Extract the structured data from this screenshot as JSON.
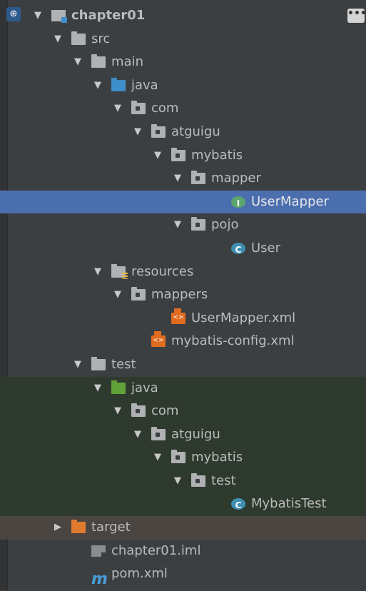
{
  "tree": [
    {
      "label": "chapter01",
      "icon": "module-icon",
      "depth": 0,
      "arrow": "down",
      "bold": true
    },
    {
      "label": "src",
      "icon": "folder-icon",
      "depth": 1,
      "arrow": "down"
    },
    {
      "label": "main",
      "icon": "folder-icon",
      "depth": 2,
      "arrow": "down"
    },
    {
      "label": "java",
      "icon": "source-folder-icon",
      "depth": 3,
      "arrow": "down"
    },
    {
      "label": "com",
      "icon": "package-icon",
      "depth": 4,
      "arrow": "down"
    },
    {
      "label": "atguigu",
      "icon": "package-icon",
      "depth": 5,
      "arrow": "down"
    },
    {
      "label": "mybatis",
      "icon": "package-icon",
      "depth": 6,
      "arrow": "down"
    },
    {
      "label": "mapper",
      "icon": "package-icon",
      "depth": 7,
      "arrow": "down"
    },
    {
      "label": "UserMapper",
      "icon": "interface-icon",
      "depth": 9,
      "arrow": "",
      "selected": true
    },
    {
      "label": "pojo",
      "icon": "package-icon",
      "depth": 7,
      "arrow": "down"
    },
    {
      "label": "User",
      "icon": "class-icon",
      "depth": 9,
      "arrow": ""
    },
    {
      "label": "resources",
      "icon": "resources-folder-icon",
      "depth": 3,
      "arrow": "down"
    },
    {
      "label": "mappers",
      "icon": "package-icon",
      "depth": 4,
      "arrow": "down"
    },
    {
      "label": "UserMapper.xml",
      "icon": "xml-file-icon",
      "depth": 6,
      "arrow": ""
    },
    {
      "label": "mybatis-config.xml",
      "icon": "xml-file-icon",
      "depth": 5,
      "arrow": ""
    },
    {
      "label": "test",
      "icon": "folder-icon",
      "depth": 2,
      "arrow": "down"
    },
    {
      "label": "java",
      "icon": "test-source-folder-icon",
      "depth": 3,
      "arrow": "down",
      "testbg": true
    },
    {
      "label": "com",
      "icon": "package-icon",
      "depth": 4,
      "arrow": "down",
      "testbg": true
    },
    {
      "label": "atguigu",
      "icon": "package-icon",
      "depth": 5,
      "arrow": "down",
      "testbg": true
    },
    {
      "label": "mybatis",
      "icon": "package-icon",
      "depth": 6,
      "arrow": "down",
      "testbg": true
    },
    {
      "label": "test",
      "icon": "package-icon",
      "depth": 7,
      "arrow": "down",
      "testbg": true
    },
    {
      "label": "MybatisTest",
      "icon": "test-class-icon",
      "depth": 9,
      "arrow": "",
      "testbg": true
    },
    {
      "label": "target",
      "icon": "excluded-folder-icon",
      "depth": 1,
      "arrow": "right",
      "excluded": true
    },
    {
      "label": "chapter01.iml",
      "icon": "iml-file-icon",
      "depth": 2,
      "arrow": ""
    },
    {
      "label": "pom.xml",
      "icon": "maven-icon",
      "depth": 2,
      "arrow": ""
    }
  ],
  "glyphs": {
    "down": "▼",
    "right": "▶",
    "interface": "I",
    "class": "C",
    "maven": "m",
    "more": "•••",
    "globe": "⊕"
  },
  "colors": {
    "background": "#3c3f41",
    "selection": "#4b6eaf",
    "test_bg": "#2f3a2f",
    "excluded_bg": "#4a4540"
  }
}
